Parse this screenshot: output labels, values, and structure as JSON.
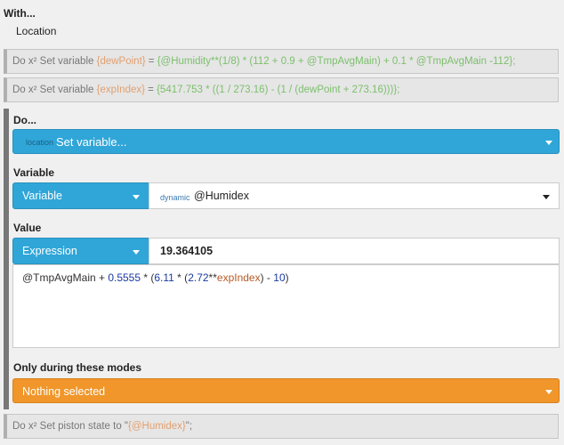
{
  "with": {
    "title": "With...",
    "item": "Location"
  },
  "statements": [
    {
      "prefix": "Do x² Set variable ",
      "var": "{dewPoint}",
      "eq": " = ",
      "expr": "{@Humidity**(1/8) * (112 + 0.9 + @TmpAvgMain) + 0.1 * @TmpAvgMain -112};"
    },
    {
      "prefix": "Do x² Set variable ",
      "var": "{expIndex}",
      "eq": " = ",
      "expr": "{5417.753 * ((1 / 273.16) - (1 / (dewPoint + 273.16)))};"
    }
  ],
  "do_block": {
    "title": "Do...",
    "action": {
      "tag": "location",
      "label": "Set variable..."
    },
    "variable": {
      "section": "Variable",
      "type_label": "Variable",
      "tag": "dynamic",
      "value": "@Humidex"
    },
    "value": {
      "section": "Value",
      "type_label": "Expression",
      "result": "19.364105",
      "expression": {
        "a": "@TmpAvgMain + ",
        "n1": "0.5555",
        "b": " * (",
        "n2": "6.11",
        "c": " * (",
        "n3": "2.72",
        "d": "**",
        "v": "expIndex",
        "e": ") - ",
        "n4": "10",
        "f": ")"
      }
    },
    "modes": {
      "section": "Only during these modes",
      "label": "Nothing selected"
    }
  },
  "last_statement": {
    "prefix": "Do x² Set piston state to \"",
    "var": "{@Humidex}",
    "suffix": "\";"
  },
  "colors": {
    "blue": "#30a6d8",
    "orange": "#f0962a",
    "var_orange": "#e0a070",
    "expr_green": "#7cbf6c"
  }
}
